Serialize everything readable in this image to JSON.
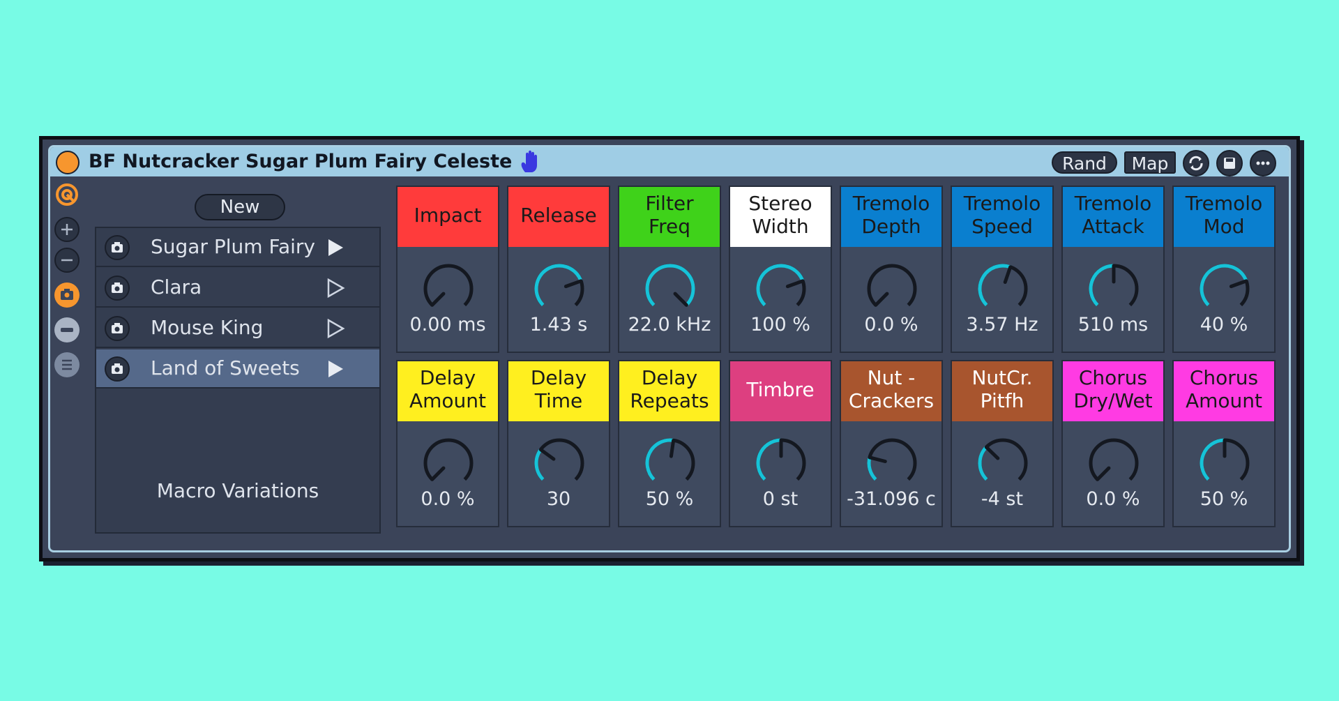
{
  "device": {
    "title": "BF Nutcracker Sugar Plum Fairy Celeste",
    "buttons": {
      "rand": "Rand",
      "map": "Map"
    }
  },
  "variations": {
    "new_label": "New",
    "items": [
      {
        "name": "Sugar Plum Fairy",
        "selected": false
      },
      {
        "name": "Clara",
        "selected": false
      },
      {
        "name": "Mouse King",
        "selected": false
      },
      {
        "name": "Land of Sweets",
        "selected": true
      }
    ],
    "caption": "Macro Variations"
  },
  "macros": [
    {
      "label": "Impact",
      "value": "0.00 ms",
      "color": "#ff3b3b",
      "text_color": "#1a1a1a",
      "amount": 0.0
    },
    {
      "label": "Release",
      "value": "1.43 s",
      "color": "#ff3b3b",
      "text_color": "#1a1a1a",
      "amount": 0.76
    },
    {
      "label": "Filter\nFreq",
      "value": "22.0 kHz",
      "color": "#3fd21a",
      "text_color": "#1a1a1a",
      "amount": 1.0
    },
    {
      "label": "Stereo\nWidth",
      "value": "100 %",
      "color": "#ffffff",
      "text_color": "#1a1a1a",
      "amount": 0.76
    },
    {
      "label": "Tremolo\nDepth",
      "value": "0.0 %",
      "color": "#0a7fcf",
      "text_color": "#1a1a1a",
      "amount": 0.0
    },
    {
      "label": "Tremolo\nSpeed",
      "value": "3.57 Hz",
      "color": "#0a7fcf",
      "text_color": "#1a1a1a",
      "amount": 0.57
    },
    {
      "label": "Tremolo\nAttack",
      "value": "510 ms",
      "color": "#0a7fcf",
      "text_color": "#1a1a1a",
      "amount": 0.5
    },
    {
      "label": "Tremolo\nMod",
      "value": "40 %",
      "color": "#0a7fcf",
      "text_color": "#1a1a1a",
      "amount": 0.76
    },
    {
      "label": "Delay\nAmount",
      "value": "0.0 %",
      "color": "#ffef1f",
      "text_color": "#1a1a1a",
      "amount": 0.0
    },
    {
      "label": "Delay\nTime",
      "value": "30",
      "color": "#ffef1f",
      "text_color": "#1a1a1a",
      "amount": 0.3
    },
    {
      "label": "Delay\nRepeats",
      "value": "50 %",
      "color": "#ffef1f",
      "text_color": "#1a1a1a",
      "amount": 0.53
    },
    {
      "label": "Timbre",
      "value": "0 st",
      "color": "#dd3f80",
      "text_color": "#ffffff",
      "amount": 0.5
    },
    {
      "label": "Nut -\nCrackers",
      "value": "-31.096 c",
      "color": "#a8552e",
      "text_color": "#ffffff",
      "amount": 0.22
    },
    {
      "label": "NutCr.\nPitfh",
      "value": "-4 st",
      "color": "#a8552e",
      "text_color": "#ffffff",
      "amount": 0.33
    },
    {
      "label": "Chorus\nDry/Wet",
      "value": "0.0 %",
      "color": "#ff3be3",
      "text_color": "#1a1a1a",
      "amount": 0.0
    },
    {
      "label": "Chorus\nAmount",
      "value": "50 %",
      "color": "#ff3be3",
      "text_color": "#1a1a1a",
      "amount": 0.5
    }
  ],
  "colors": {
    "accent_orange": "#f7962e",
    "knob_arc": "#16c3d8",
    "panel": "#3b4459",
    "titlebar": "#9fcde5"
  },
  "icons": {
    "title_icon": "hand-icon",
    "top_right": [
      "refresh-icon",
      "save-icon",
      "more-icon"
    ],
    "side": [
      "rack-icon",
      "add-icon",
      "remove-icon",
      "camera-icon",
      "chain-icon",
      "list-icon"
    ]
  }
}
